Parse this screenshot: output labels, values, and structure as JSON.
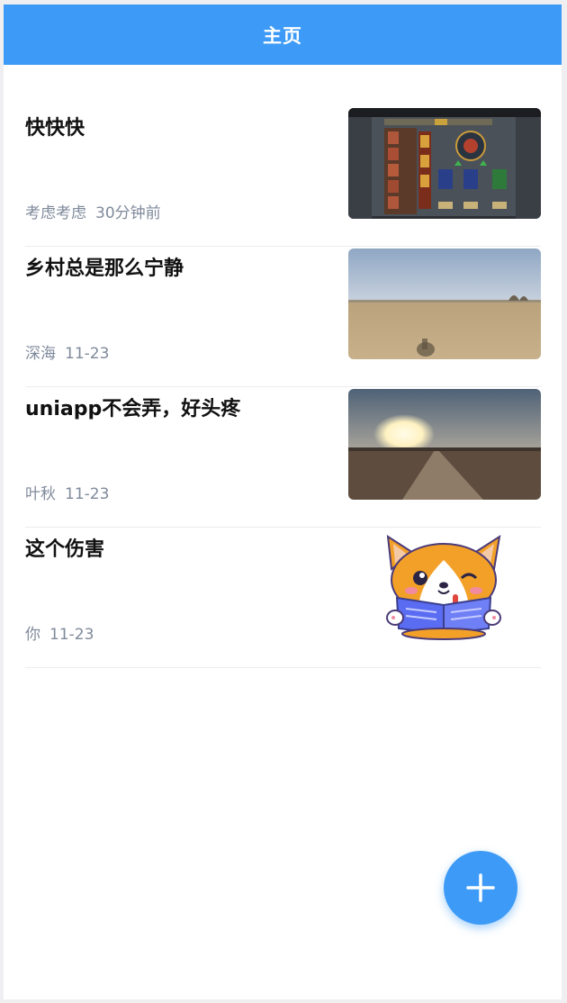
{
  "navbar": {
    "title": "主页"
  },
  "posts": [
    {
      "title": "快快快",
      "author": "考虑考虑",
      "time": "30分钟前",
      "thumbnail_icon": "game-screenshot-image"
    },
    {
      "title": "乡村总是那么宁静",
      "author": "深海",
      "time": "11-23",
      "thumbnail_icon": "countryside-field-image"
    },
    {
      "title": "uniapp不会弄，好头疼",
      "author": "叶秋",
      "time": "11-23",
      "thumbnail_icon": "sunset-road-image"
    },
    {
      "title": "这个伤害",
      "author": "你",
      "time": "11-23",
      "thumbnail_icon": "corgi-reading-sticker"
    }
  ],
  "fab": {
    "icon": "plus-icon",
    "color": "#3d9bf7"
  },
  "colors": {
    "primary": "#3d9bf7",
    "meta_text": "#7f8a9b",
    "title_text": "#111111"
  }
}
